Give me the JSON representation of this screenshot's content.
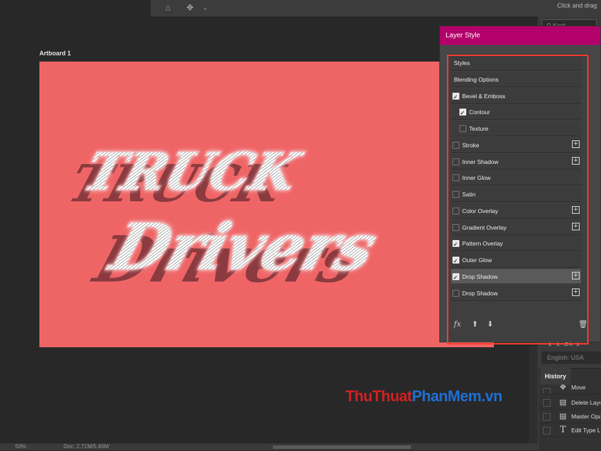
{
  "toolbar": {
    "hint": "Click and drag"
  },
  "layers_panel": {
    "search_placeholder": "Kind"
  },
  "canvas": {
    "artboard_name": "Artboard 1",
    "artboard_color": "#ef6566",
    "art_line1": "TRUCK",
    "art_line2": "Drivers"
  },
  "character_panel": {
    "language": "English: USA",
    "style_buttons": "T   T   St  T"
  },
  "history": {
    "tab_label": "History",
    "items": [
      {
        "label": "Move",
        "icon": "move-icon"
      },
      {
        "label": "Delete Layer",
        "icon": "document-icon"
      },
      {
        "label": "Master Opacity",
        "icon": "document-icon"
      },
      {
        "label": "Edit Type Layer",
        "icon": "type-icon"
      }
    ]
  },
  "layer_style": {
    "title": "Layer Style",
    "title_color": "#b4006a",
    "items": [
      {
        "label": "Styles",
        "checkbox": false,
        "checked": false,
        "plus": false,
        "indent": false,
        "selected": false
      },
      {
        "label": "Blending Options",
        "checkbox": false,
        "checked": false,
        "plus": false,
        "indent": false,
        "selected": false
      },
      {
        "label": "Bevel & Emboss",
        "checkbox": true,
        "checked": true,
        "plus": false,
        "indent": false,
        "selected": false
      },
      {
        "label": "Contour",
        "checkbox": true,
        "checked": true,
        "plus": false,
        "indent": true,
        "selected": false
      },
      {
        "label": "Texture",
        "checkbox": true,
        "checked": false,
        "plus": false,
        "indent": true,
        "selected": false
      },
      {
        "label": "Stroke",
        "checkbox": true,
        "checked": false,
        "plus": true,
        "indent": false,
        "selected": false
      },
      {
        "label": "Inner Shadow",
        "checkbox": true,
        "checked": false,
        "plus": true,
        "indent": false,
        "selected": false
      },
      {
        "label": "Inner Glow",
        "checkbox": true,
        "checked": false,
        "plus": false,
        "indent": false,
        "selected": false
      },
      {
        "label": "Satin",
        "checkbox": true,
        "checked": false,
        "plus": false,
        "indent": false,
        "selected": false
      },
      {
        "label": "Color Overlay",
        "checkbox": true,
        "checked": false,
        "plus": true,
        "indent": false,
        "selected": false
      },
      {
        "label": "Gradient Overlay",
        "checkbox": true,
        "checked": false,
        "plus": true,
        "indent": false,
        "selected": false
      },
      {
        "label": "Pattern Overlay",
        "checkbox": true,
        "checked": true,
        "plus": false,
        "indent": false,
        "selected": false
      },
      {
        "label": "Outer Glow",
        "checkbox": true,
        "checked": true,
        "plus": false,
        "indent": false,
        "selected": false
      },
      {
        "label": "Drop Shadow",
        "checkbox": true,
        "checked": true,
        "plus": true,
        "indent": false,
        "selected": true
      },
      {
        "label": "Drop Shadow",
        "checkbox": true,
        "checked": false,
        "plus": true,
        "indent": false,
        "selected": false
      }
    ],
    "footer": {
      "fx_label": "fx"
    }
  },
  "watermark": {
    "part1": "ThuThuat",
    "part2": "PhanMem",
    "part3": ".vn",
    "color_red": "#d42020",
    "color_blue": "#1e6fd6"
  },
  "status_bar": {
    "zoom": "50%",
    "doc": "Doc: 2.71M/5.46M"
  }
}
